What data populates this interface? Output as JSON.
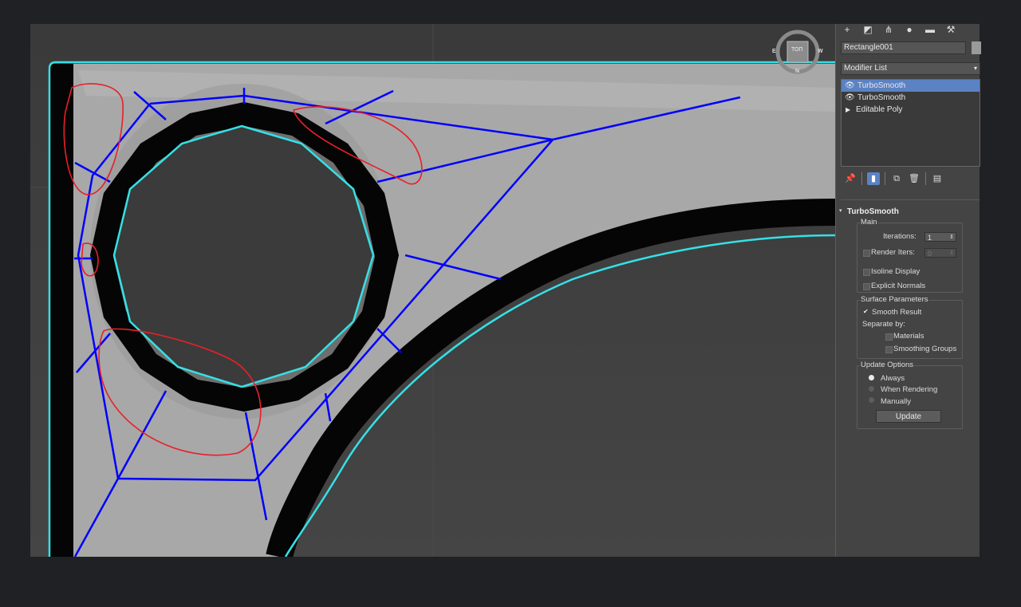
{
  "object_name": "Rectangle001",
  "modifier_list_label": "Modifier List",
  "modifier_stack": [
    {
      "label": "TurboSmooth",
      "selected": true,
      "icon": "eye-icon"
    },
    {
      "label": "TurboSmooth",
      "selected": false,
      "icon": "eye-icon"
    },
    {
      "label": "Editable Poly",
      "selected": false,
      "icon": "expand-triangle-icon"
    }
  ],
  "viewcube": {
    "label": "ТОП",
    "n": "N",
    "e": "E",
    "w": "W"
  },
  "rollout": {
    "title": "TurboSmooth",
    "main": {
      "title": "Main",
      "iterations_label": "Iterations:",
      "iterations_value": "1",
      "render_iters_label": "Render Iters:",
      "render_iters_value": "0",
      "isoline_label": "Isoline Display",
      "explicit_normals_label": "Explicit Normals"
    },
    "surface": {
      "title": "Surface Parameters",
      "smooth_result_label": "Smooth Result",
      "separate_by_label": "Separate by:",
      "materials_label": "Materials",
      "smoothing_groups_label": "Smoothing Groups"
    },
    "update": {
      "title": "Update Options",
      "always_label": "Always",
      "when_rendering_label": "When Rendering",
      "manually_label": "Manually",
      "update_button": "Update"
    }
  },
  "colors": {
    "wire_cyan": "#35e0e6",
    "annotation_blue": "#0000ff",
    "annotation_red": "#e8202a",
    "selection": "#5b82c3"
  }
}
